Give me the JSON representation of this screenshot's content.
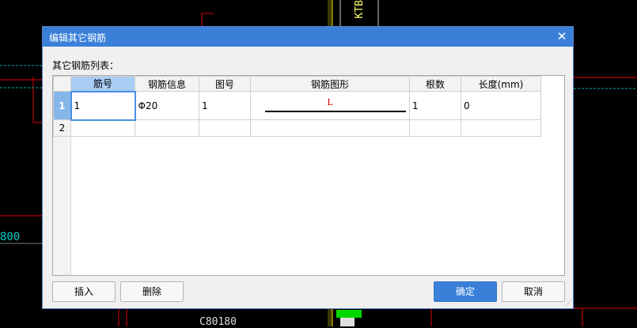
{
  "background": {
    "labels": {
      "ktb": "KTB",
      "dim800": "800",
      "c80": "C80180"
    }
  },
  "dialog": {
    "title": "编辑其它钢筋",
    "close_icon": "close-icon",
    "section_label": "其它钢筋列表：",
    "grid": {
      "columns": [
        "筋号",
        "钢筋信息",
        "图号",
        "钢筋图形",
        "根数",
        "长度(mm)"
      ],
      "rows": [
        {
          "num": "1",
          "bar_no": "1",
          "rebar_info": "Φ20",
          "figure_no": "1",
          "shape_label": "L",
          "count": "1",
          "length": "0"
        },
        {
          "num": "2",
          "bar_no": "",
          "rebar_info": "",
          "figure_no": "",
          "shape_label": "",
          "count": "",
          "length": ""
        }
      ]
    },
    "buttons": {
      "insert": "插入",
      "delete": "删除",
      "ok": "确定",
      "cancel": "取消"
    }
  },
  "colors": {
    "titlebar": "#3a80d9",
    "selected_header": "#a9cdf5",
    "active_row": "#87b6ea",
    "cell_focus_border": "#4a90e2",
    "shape_label": "#d40000"
  }
}
